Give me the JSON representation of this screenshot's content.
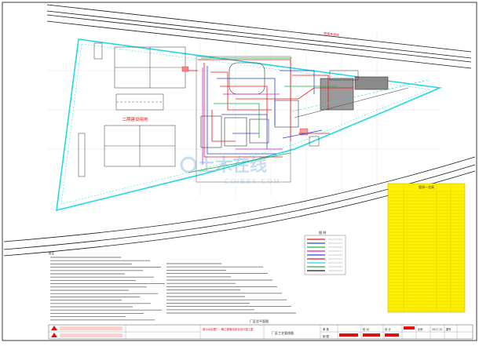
{
  "labels": {
    "road_label": "铁路专用线",
    "phase2_label": "二期建设用地",
    "watermark_cn": "土木在线",
    "watermark_en": "COIBBS.COM",
    "notes_title": "附注",
    "site_plan_caption": "厂区总平面图",
    "title_drawing_name": "厂区工艺管线图",
    "title_project": "某污水处理厂一期工程管线综合设计施工图",
    "legend_title": "图 例",
    "table_title": "管线一览表",
    "date": "2017.12",
    "scale_label": "比例",
    "sheet_label": "图号",
    "review_label": "审 核",
    "check_label": "校 对",
    "design_label": "设 计",
    "drawing_label": "制 图"
  },
  "colors": {
    "boundary": "#22d8e6",
    "road": "#1a1a1a",
    "grid": "#b8b8b8",
    "pipe_red": "#e8171d",
    "pipe_blue": "#2a44e0",
    "pipe_green": "#1fb33a",
    "pipe_magenta": "#d21fd6",
    "table_fill": "#ffef00",
    "title_red": "#e01010",
    "watermark": "#5aa0d8"
  }
}
